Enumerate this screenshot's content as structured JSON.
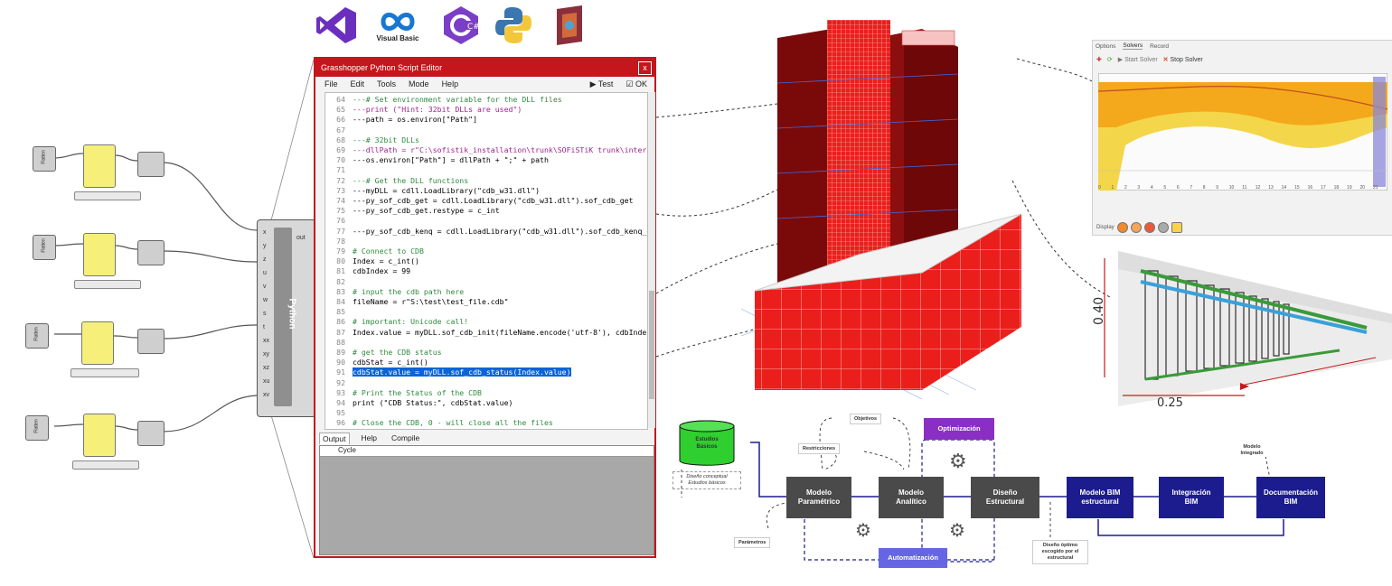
{
  "grasshopper": {
    "node_labels": [
      "Flatten",
      "Flatten",
      "Flatten",
      "Flatten"
    ],
    "python_component_label": "Python",
    "python_inputs": [
      "x",
      "y",
      "z",
      "u",
      "v",
      "w",
      "s",
      "t",
      "xx",
      "xy",
      "xz",
      "xu",
      "xv"
    ],
    "python_output": "out"
  },
  "logos": {
    "visual_basic_label": "Visual Basic",
    "csharp_label": "C#"
  },
  "editor": {
    "title": "Grasshopper Python Script Editor",
    "close": "x",
    "menu": [
      "File",
      "Edit",
      "Tools",
      "Mode",
      "Help"
    ],
    "test_label": "Test",
    "ok_label": "OK",
    "code_lines": [
      {
        "n": "64",
        "t": "---# Set environment variable for the DLL files",
        "c": "cm"
      },
      {
        "n": "65",
        "t": "---print (\"Hint: 32bit DLLs are used\")",
        "c": "st"
      },
      {
        "n": "66",
        "t": "---path = os.environ[\"Path\"]",
        "c": ""
      },
      {
        "n": "67",
        "t": "",
        "c": ""
      },
      {
        "n": "68",
        "t": "---# 32bit DLLs",
        "c": "cm"
      },
      {
        "n": "69",
        "t": "---dllPath = r\"C:\\sofistik_installation\\trunk\\SOFiSTiK trunk\\interf",
        "c": "st"
      },
      {
        "n": "70",
        "t": "---os.environ[\"Path\"] = dllPath + \";\" + path",
        "c": ""
      },
      {
        "n": "71",
        "t": "",
        "c": ""
      },
      {
        "n": "72",
        "t": "---# Get the DLL functions",
        "c": "cm"
      },
      {
        "n": "73",
        "t": "---myDLL = cdll.LoadLibrary(\"cdb_w31.dll\")",
        "c": ""
      },
      {
        "n": "74",
        "t": "---py_sof_cdb_get = cdll.LoadLibrary(\"cdb_w31.dll\").sof_cdb_get",
        "c": ""
      },
      {
        "n": "75",
        "t": "---py_sof_cdb_get.restype = c_int",
        "c": ""
      },
      {
        "n": "76",
        "t": "",
        "c": ""
      },
      {
        "n": "77",
        "t": "---py_sof_cdb_kenq = cdll.LoadLibrary(\"cdb_w31.dll\").sof_cdb_kenq_e",
        "c": ""
      },
      {
        "n": "78",
        "t": "",
        "c": ""
      },
      {
        "n": "79",
        "t": "# Connect to CDB",
        "c": "cm"
      },
      {
        "n": "80",
        "t": "Index = c_int()",
        "c": ""
      },
      {
        "n": "81",
        "t": "cdbIndex = 99",
        "c": ""
      },
      {
        "n": "82",
        "t": "",
        "c": ""
      },
      {
        "n": "83",
        "t": "# input the cdb path here",
        "c": "cm"
      },
      {
        "n": "84",
        "t": "fileName = r\"S:\\test\\test_file.cdb\"",
        "c": ""
      },
      {
        "n": "85",
        "t": "",
        "c": ""
      },
      {
        "n": "86",
        "t": "# important: Unicode call!",
        "c": "cm"
      },
      {
        "n": "87",
        "t": "Index.value = myDLL.sof_cdb_init(fileName.encode('utf-8'), cdbIndex",
        "c": ""
      },
      {
        "n": "88",
        "t": "",
        "c": ""
      },
      {
        "n": "89",
        "t": "# get the CDB status",
        "c": "cm"
      },
      {
        "n": "90",
        "t": "cdbStat = c_int()",
        "c": ""
      },
      {
        "n": "91",
        "t": "cdbStat.value = myDLL.sof_cdb_status(Index.value)",
        "c": "hl"
      },
      {
        "n": "92",
        "t": "",
        "c": ""
      },
      {
        "n": "93",
        "t": "# Print the Status of the CDB",
        "c": "cm"
      },
      {
        "n": "94",
        "t": "print (\"CDB Status:\", cdbStat.value)",
        "c": ""
      },
      {
        "n": "95",
        "t": "",
        "c": ""
      },
      {
        "n": "96",
        "t": "# Close the CDB, 0 - will close all the files",
        "c": "cm"
      }
    ],
    "output_tabs": [
      "Output",
      "Help",
      "Compile"
    ],
    "output_column": "Cycle"
  },
  "solver": {
    "tabs": [
      "Options",
      "Solvers",
      "Record"
    ],
    "start_label": "Start Solver",
    "stop_label": "Stop Solver",
    "x_ticks": [
      "0",
      "1",
      "2",
      "3",
      "4",
      "5",
      "6",
      "7",
      "8",
      "9",
      "10",
      "11",
      "12",
      "13",
      "14",
      "15",
      "16",
      "17",
      "18",
      "19",
      "20",
      "21"
    ],
    "display_label": "Display"
  },
  "dimension": {
    "vertical": "0.40",
    "horizontal": "0.25"
  },
  "flowchart": {
    "estudios_basicos": "Estudios\nBásicos",
    "diseno_conceptual": "Diseño conceptual\nEstudios básicos",
    "objetivos": "Objetivos",
    "restricciones": "Restricciones",
    "optimizacion": "Optimización",
    "automatizacion": "Automatización",
    "parametros": "Parámetros",
    "modelo_parametrico": "Modelo\nParamétrico",
    "modelo_analitico": "Modelo\nAnalítico",
    "diseno_estructural": "Diseño\nEstructural",
    "modelo_bim": "Modelo BIM\nestructural",
    "integracion_bim": "Integración\nBIM",
    "documentacion_bim": "Documentación\nBIM",
    "modelo_integrado": "Modelo\nIntegrado",
    "diseno_optimo": "Diseño óptimo\nescogido por el\nestructural"
  }
}
